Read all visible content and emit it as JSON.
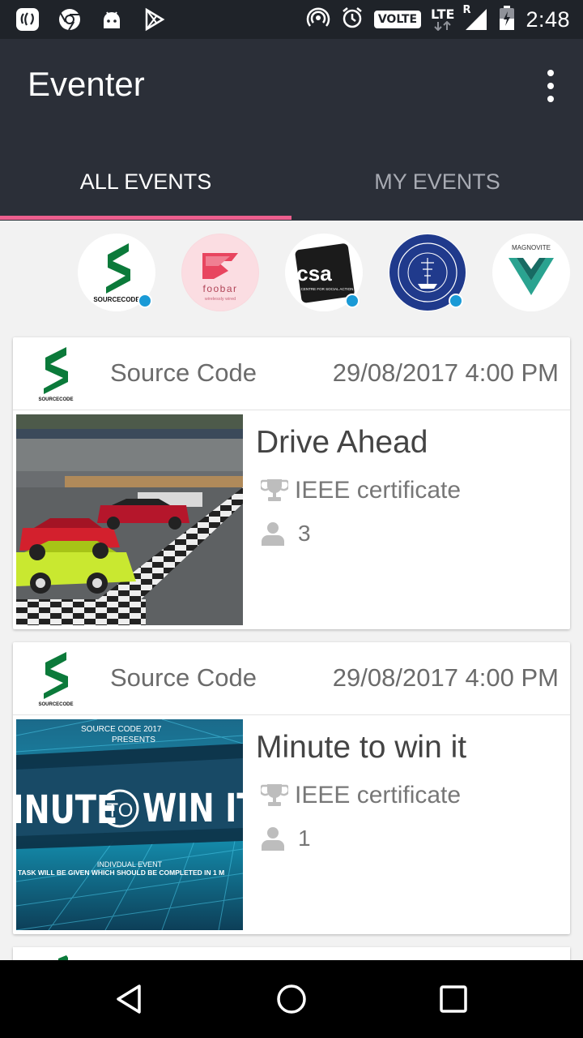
{
  "status_bar": {
    "left_icons": [
      "saavn-icon",
      "chrome-icon",
      "android-icon",
      "play-store-icon"
    ],
    "volte": "VOLTE",
    "lte": "LTE",
    "roaming": "R",
    "time": "2:48"
  },
  "app": {
    "title": "Eventer",
    "tabs": [
      {
        "label": "ALL EVENTS",
        "active": true
      },
      {
        "label": "MY EVENTS",
        "active": false
      }
    ],
    "accent_color": "#ec5f8e"
  },
  "organizers": [
    {
      "name": "sourcecode-logo",
      "unread": true
    },
    {
      "name": "foobar-logo",
      "unread": false,
      "text": "foobar",
      "tagline": "wirelessly wired"
    },
    {
      "name": "csa-logo",
      "unread": true,
      "text": "csa",
      "subtext": "CENTRE FOR SOCIAL ACTION"
    },
    {
      "name": "christ-university-logo",
      "unread": true
    },
    {
      "name": "magnovite-logo",
      "unread": false,
      "text": "MAGNOVITE"
    }
  ],
  "events": [
    {
      "organizer": "Source Code",
      "date": "29/08/2017 4:00 PM",
      "title": "Drive Ahead",
      "certificate": "IEEE certificate",
      "participants": "3"
    },
    {
      "organizer": "Source Code",
      "date": "29/08/2017 4:00 PM",
      "title": "Minute to win it",
      "certificate": "IEEE certificate",
      "participants": "1",
      "poster": {
        "line1": "SOURCE CODE 2017",
        "line2": "PRESENTS",
        "left": "INUTE",
        "mid": "TO",
        "right": "WIN IT",
        "sub1": "INDIVDUAL EVENT",
        "sub2": "TASK WILL BE GIVEN WHICH SHOULD BE COMPLETED IN 1 M"
      }
    }
  ],
  "logo_caption": "SOURCECODE"
}
